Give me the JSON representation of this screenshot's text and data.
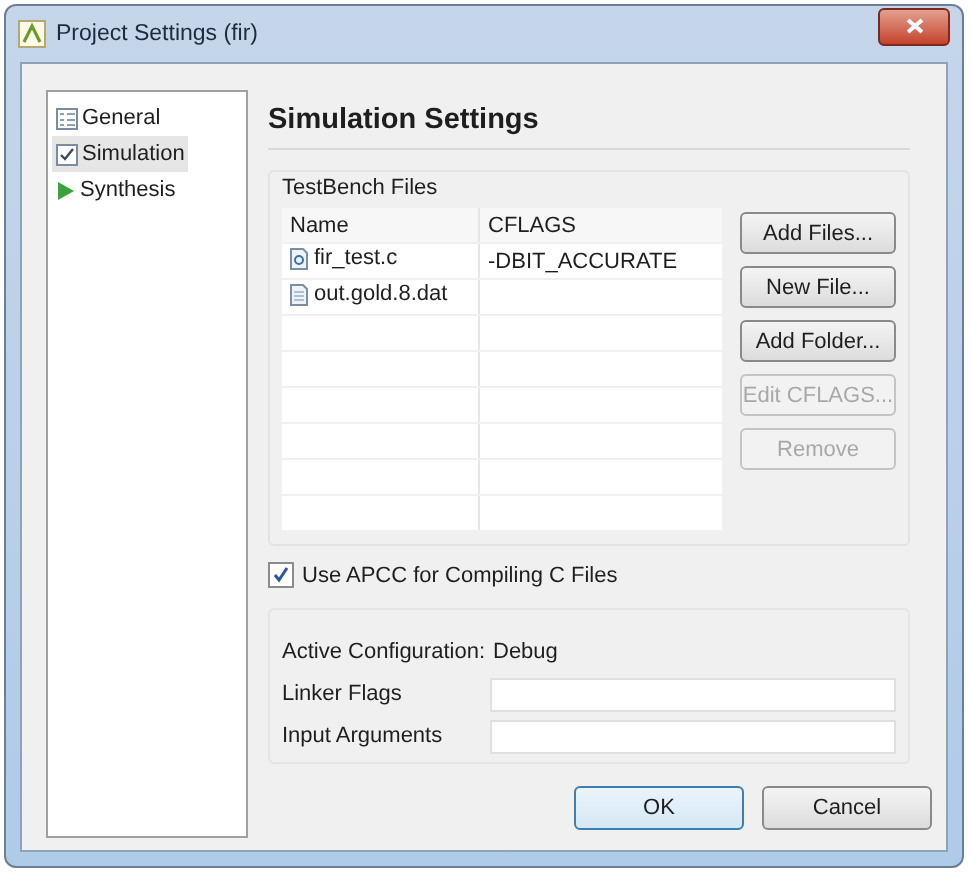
{
  "window": {
    "title": "Project Settings (fir)"
  },
  "sidebar": {
    "items": [
      {
        "label": "General",
        "kind": "page",
        "selected": false
      },
      {
        "label": "Simulation",
        "kind": "check",
        "selected": true
      },
      {
        "label": "Synthesis",
        "kind": "run",
        "selected": false
      }
    ]
  },
  "heading": "Simulation Settings",
  "testbench": {
    "title": "TestBench Files",
    "table": {
      "columns": [
        "Name",
        "CFLAGS"
      ],
      "rows": [
        {
          "kind": "source",
          "name": "fir_test.c",
          "cflags": "-DBIT_ACCURATE"
        },
        {
          "kind": "data",
          "name": "out.gold.8.dat"
        }
      ]
    },
    "buttons": [
      {
        "label": "Add Files...",
        "disabled": false
      },
      {
        "label": "New File...",
        "disabled": false
      },
      {
        "label": "Add Folder...",
        "disabled": false
      },
      {
        "label": "Edit CFLAGS...",
        "disabled": true
      },
      {
        "label": "Remove",
        "disabled": true
      }
    ]
  },
  "use_apcc": {
    "label": "Use APCC for Compiling C Files",
    "checked": true
  },
  "config": {
    "label": "Active Configuration:",
    "value": "Debug",
    "fields": [
      {
        "label": "Linker Flags"
      },
      {
        "label": "Input Arguments"
      }
    ]
  },
  "footer": {
    "buttons": [
      {
        "label": "OK",
        "default": true
      },
      {
        "label": "Cancel",
        "default": false
      }
    ]
  }
}
